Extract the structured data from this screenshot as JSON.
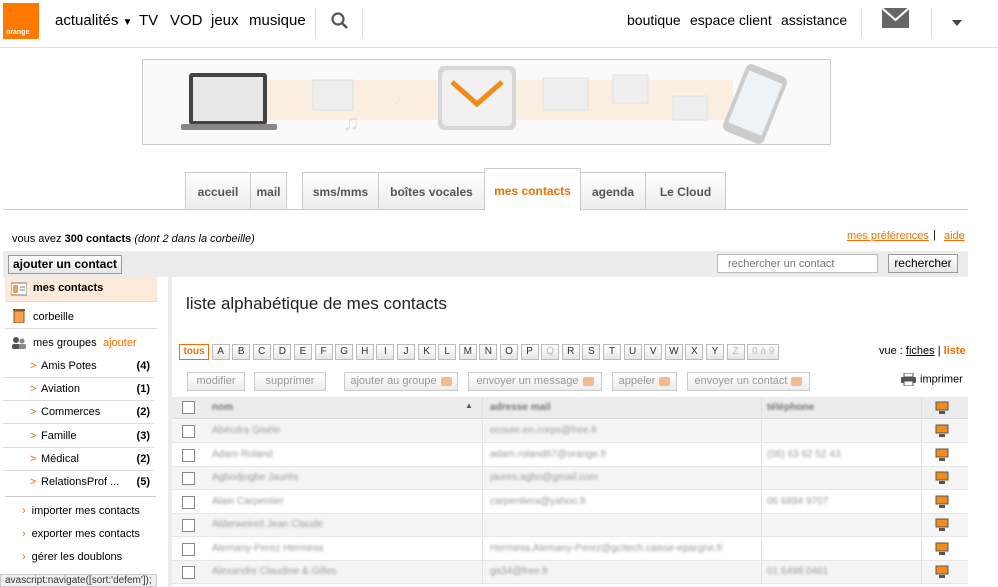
{
  "logo": {
    "text": "orange"
  },
  "topnav": {
    "left": [
      "actualités",
      "TV",
      "VOD",
      "jeux",
      "musique"
    ],
    "right": [
      "boutique",
      "espace client",
      "assistance"
    ]
  },
  "tabs": [
    "accueil",
    "mail",
    "sms/mms",
    "boîtes vocales",
    "mes contacts",
    "agenda",
    "Le Cloud"
  ],
  "info": {
    "prefix": "vous avez",
    "count": "300 contacts",
    "suffix": "(dont 2 dans la corbeille)",
    "prefs": "mes préférences",
    "sep": "|",
    "help": "aide"
  },
  "toolbar": {
    "add_contact": "ajouter un contact",
    "search_placeholder": "rechercher un contact",
    "search_button": "rechercher"
  },
  "sidebar": {
    "my_contacts": "mes contacts",
    "trash": "corbeille",
    "groups": "mes groupes",
    "add": "ajouter",
    "group_items": [
      {
        "label": "Amis Potes",
        "count": "(4)"
      },
      {
        "label": "Aviation",
        "count": "(1)"
      },
      {
        "label": "Commerces",
        "count": "(2)"
      },
      {
        "label": "Famille",
        "count": "(3)"
      },
      {
        "label": "Médical",
        "count": "(2)"
      },
      {
        "label": "RelationsProf ...",
        "count": "(5)"
      }
    ],
    "actions": [
      "importer mes contacts",
      "exporter mes contacts",
      "gérer les doublons"
    ]
  },
  "main": {
    "title": "liste alphabétique de mes contacts",
    "letters": [
      "tous",
      "A",
      "B",
      "C",
      "D",
      "E",
      "F",
      "G",
      "H",
      "I",
      "J",
      "K",
      "L",
      "M",
      "N",
      "O",
      "P",
      "Q",
      "R",
      "S",
      "T",
      "U",
      "V",
      "W",
      "X",
      "Y",
      "Z",
      "0 à 9"
    ],
    "view_label": "vue :",
    "view_cards": "fiches",
    "view_sep": "|",
    "view_list": "liste",
    "actions": [
      "modifier",
      "supprimer",
      "ajouter au groupe",
      "envoyer un message",
      "appeler",
      "envoyer un contact"
    ],
    "print": "imprimer",
    "columns": [
      "nom",
      "adresse mail",
      "téléphone"
    ],
    "rows": [
      {
        "name": "Abécdra Gisèle",
        "email": "ecoute.en.corps@free.fr",
        "phone": ""
      },
      {
        "name": "Adam Roland",
        "email": "adam.roland67@orange.fr",
        "phone": "(06) 63 62 52 43"
      },
      {
        "name": "Agbodjogbe Jaurès",
        "email": "jaures.agbo@gmail.com",
        "phone": ""
      },
      {
        "name": "Alain Carpentier",
        "email": "carpentiera@yahoo.fr",
        "phone": "06 6894 9707"
      },
      {
        "name": "Alderweireit Jean Claude",
        "email": "",
        "phone": ""
      },
      {
        "name": "Alemany-Perez Herminia",
        "email": "Herminia.Alemany-Perez@gcitech.caisse-epargne.fr",
        "phone": ""
      },
      {
        "name": "Alexandre Claudine & Gilles",
        "email": "ga34@free.fr",
        "phone": "01 6498 0461"
      }
    ]
  },
  "status": "avascript:navigate([sort:'defem']);"
}
